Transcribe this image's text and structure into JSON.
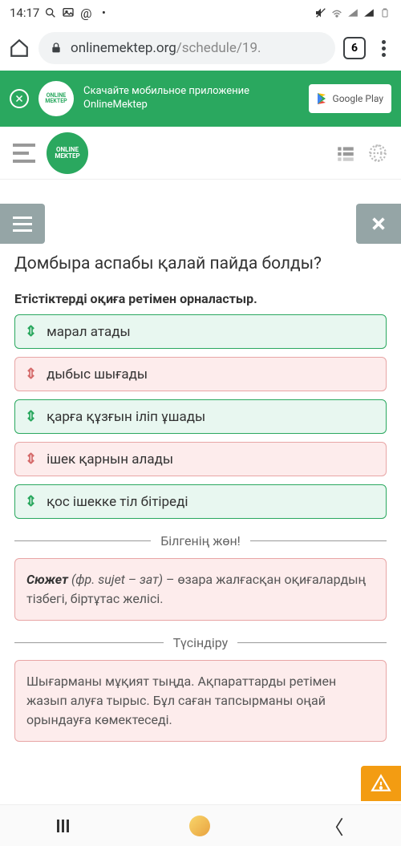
{
  "status": {
    "time": "14:17",
    "icons_left": [
      "search",
      "image",
      "at",
      "dot"
    ],
    "icons_right": [
      "mute",
      "wifi",
      "signal1",
      "signal2",
      "battery"
    ]
  },
  "browser": {
    "url_secure": "onlinemektep.org",
    "url_path": "/schedule/19.",
    "tab_count": "6"
  },
  "banner": {
    "logo_text": "ONLINE MEKTEP",
    "text": "Скачайте мобильное приложение OnlineMektep",
    "button": "Google Play"
  },
  "site_header": {
    "logo_text": "ONLINE MEKTEP"
  },
  "question": {
    "title": "Домбыра аспабы қалай пайда болды?",
    "instruction": "Етістіктерді оқиға ретімен орналастыр.",
    "options": [
      {
        "text": "марал атады",
        "correct": true
      },
      {
        "text": "дыбыс шығады",
        "correct": false
      },
      {
        "text": "қарға құзғын іліп ұшады",
        "correct": true
      },
      {
        "text": "ішек қарнын алады",
        "correct": false
      },
      {
        "text": "қос ішекке тіл бітіреді",
        "correct": true
      }
    ]
  },
  "feedback": {
    "heading": "Білгенің жөн!",
    "term_bold": "Сюжет",
    "term_italic": "(фр. sujet – зат)",
    "term_rest": " – өзара жалғасқан оқиғалардың тізбегі, біртұтас желісі."
  },
  "explain": {
    "heading": "Түсіндіру",
    "text": "Шығарманы мұқият тыңда. Ақпараттарды ретімен жазып алуға тырыс. Бұл саған тапсырманы оңай орындауға көмектеседі."
  }
}
